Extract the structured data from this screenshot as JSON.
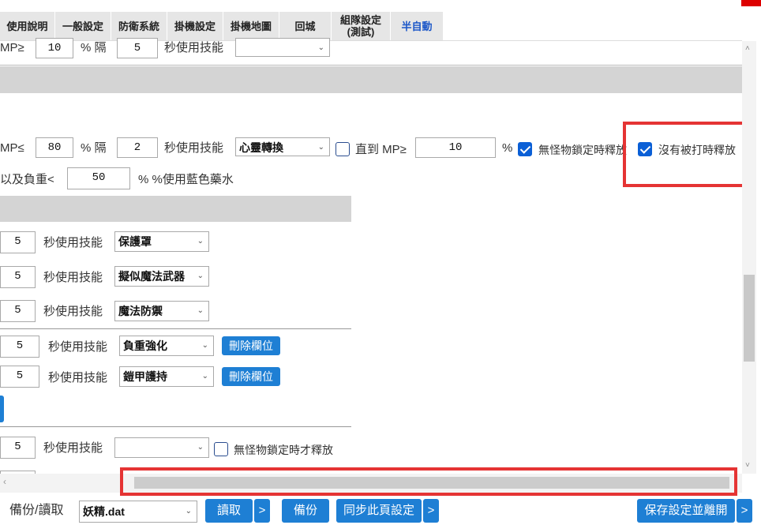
{
  "tabs": [
    {
      "label": "使用說明"
    },
    {
      "label": "一般設定"
    },
    {
      "label": "防衛系統"
    },
    {
      "label": "掛機設定"
    },
    {
      "label": "掛機地圖"
    },
    {
      "label": "回城"
    },
    {
      "label": "組隊設定\n(測試)"
    },
    {
      "label": "半自動"
    }
  ],
  "row_top": {
    "prefix": "MP≥",
    "percent_value": "10",
    "percent_label": "% 隔",
    "seconds_value": "5",
    "seconds_label": "秒使用技能",
    "skill": ""
  },
  "row_mp": {
    "prefix": "MP≤",
    "percent_value": "80",
    "percent_label": "% 隔",
    "seconds_value": "2",
    "seconds_label": "秒使用技能",
    "skill": "心靈轉換",
    "until_label": "直到 MP≥",
    "until_value": "10",
    "until_suffix": "%",
    "no_monster_label": "無怪物鎖定時釋放",
    "no_hit_label": "沒有被打時釋放"
  },
  "row_weight": {
    "prefix": "以及負重<",
    "value": "50",
    "suffix": "% %使用藍色藥水"
  },
  "skill_rows": [
    {
      "seconds": "5",
      "label": "秒使用技能",
      "skill": "保護罩"
    },
    {
      "seconds": "5",
      "label": "秒使用技能",
      "skill": "擬似魔法武器"
    },
    {
      "seconds": "5",
      "label": "秒使用技能",
      "skill": "魔法防禦"
    }
  ],
  "skill_rows_b": [
    {
      "seconds": "5",
      "label": "秒使用技能",
      "skill": "負重強化",
      "delete": "刪除欄位"
    },
    {
      "seconds": "5",
      "label": "秒使用技能",
      "skill": "鎧甲護持",
      "delete": "刪除欄位"
    }
  ],
  "row_bottom": {
    "seconds": "5",
    "label": "秒使用技能",
    "skill": "",
    "checkbox_label": "無怪物鎖定時才釋放"
  },
  "footer": {
    "backup_label": "備份/讀取",
    "file": "妖精.dat",
    "read": "讀取",
    "arrow": ">",
    "backup": "備份",
    "sync": "同步此頁設定",
    "save_leave": "保存設定並離開"
  }
}
